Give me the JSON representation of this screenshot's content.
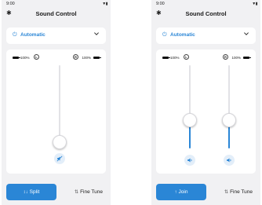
{
  "colors": {
    "accent": "#2a86d6",
    "accent_soft": "#e3eef9",
    "background": "#f1f1f3"
  },
  "screens": [
    {
      "status": {
        "time": "9:00",
        "icons": "▼▮"
      },
      "header": {
        "title": "Sound Control",
        "settings_icon": "gear-icon"
      },
      "mode": {
        "label": "Automatic",
        "icon": "power-icon",
        "dropdown_icon": "chevron-down-icon"
      },
      "sliders": {
        "left": {
          "battery": "100%",
          "ear_label": "L",
          "level": 0.05,
          "muted": true
        },
        "right": {
          "battery": "100%",
          "ear_label": "R"
        }
      },
      "bottom": {
        "primary_label": "Split",
        "primary_icon": "↕↓",
        "secondary_label": "Fine Tune",
        "secondary_icon": "⇅"
      }
    },
    {
      "status": {
        "time": "9:00",
        "icons": "▼▮"
      },
      "header": {
        "title": "Sound Control",
        "settings_icon": "gear-icon"
      },
      "mode": {
        "label": "Automatic",
        "icon": "power-icon",
        "dropdown_icon": "chevron-down-icon"
      },
      "sliders": {
        "left": {
          "battery": "100%",
          "ear_label": "L",
          "level": 0.33,
          "muted": false
        },
        "right": {
          "battery": "100%",
          "ear_label": "R",
          "level": 0.33,
          "muted": false
        }
      },
      "bottom": {
        "primary_label": "Join",
        "primary_icon": "↑",
        "secondary_label": "Fine Tune",
        "secondary_icon": "⇅"
      }
    }
  ]
}
